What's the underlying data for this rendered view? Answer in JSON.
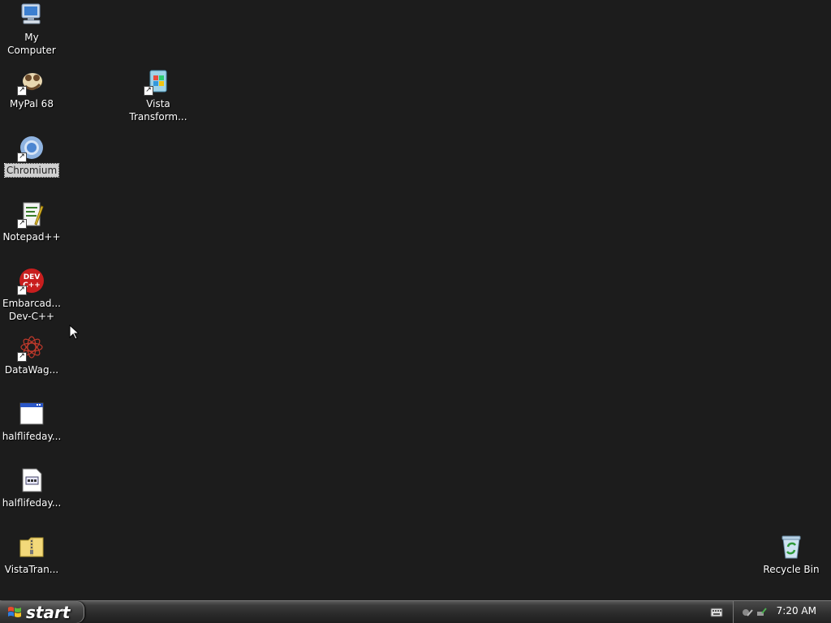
{
  "desktop": {
    "icons": [
      {
        "name": "my-computer",
        "label": "My\nComputer",
        "icon": "computer-icon"
      },
      {
        "name": "mypal-68",
        "label": "MyPal 68",
        "icon": "mypal-icon"
      },
      {
        "name": "vista-transform",
        "label": "Vista\nTransform...",
        "icon": "vista-transform-icon"
      },
      {
        "name": "chromium",
        "label": "Chromium",
        "icon": "chromium-icon"
      },
      {
        "name": "notepad-plus-plus",
        "label": "Notepad++",
        "icon": "notepad-plus-plus-icon"
      },
      {
        "name": "embarcadero-dev-cpp",
        "label": "Embarcad...\nDev-C++",
        "icon": "dev-cpp-icon"
      },
      {
        "name": "datawag",
        "label": "DataWag...",
        "icon": "datawag-icon"
      },
      {
        "name": "halflifeday-1",
        "label": "halflifeday...",
        "icon": "window-app-icon"
      },
      {
        "name": "halflifeday-2",
        "label": "halflifeday...",
        "icon": "document-icon"
      },
      {
        "name": "vistatran",
        "label": "VistaTran...",
        "icon": "zip-folder-icon"
      },
      {
        "name": "recycle-bin",
        "label": "Recycle Bin",
        "icon": "recycle-bin-icon"
      }
    ]
  },
  "taskbar": {
    "start_label": "start",
    "clock": "7:20 AM"
  },
  "colors": {
    "desktop_bg": "#1c1c1c",
    "taskbar": "#2a2a2a"
  }
}
